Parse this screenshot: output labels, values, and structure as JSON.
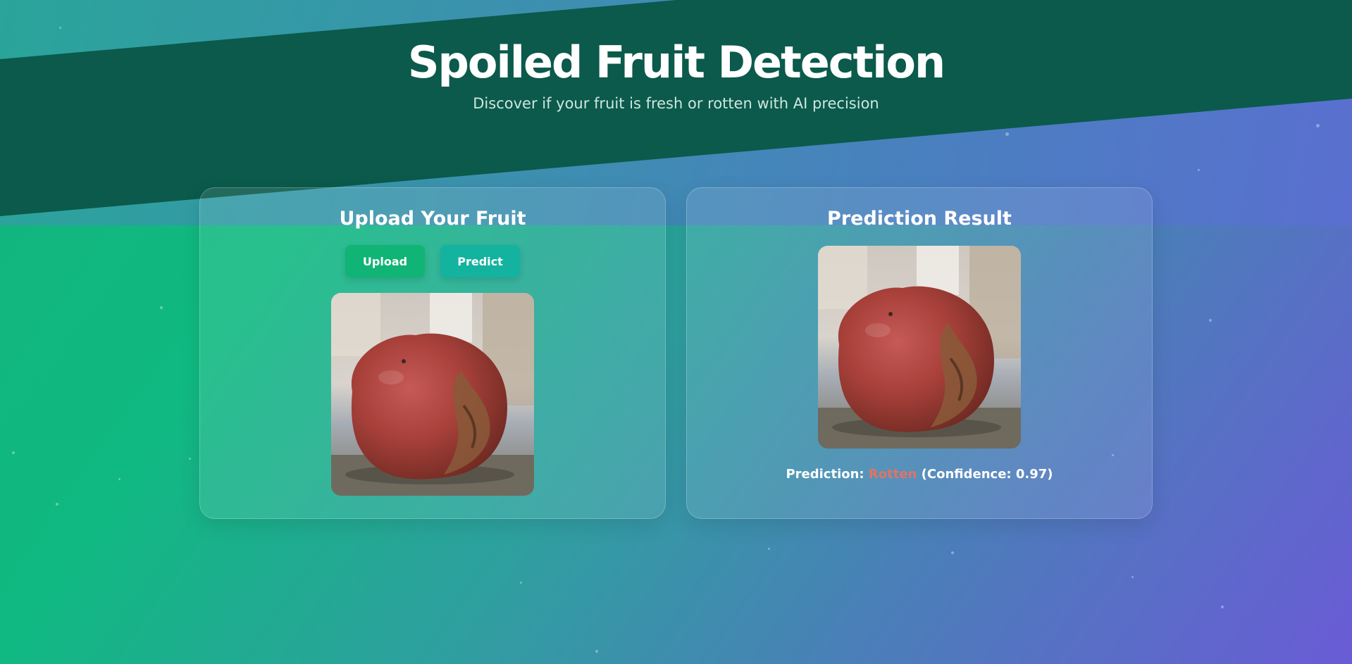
{
  "header": {
    "title": "Spoiled Fruit Detection",
    "subtitle": "Discover if your fruit is fresh or rotten with AI precision"
  },
  "upload_card": {
    "title": "Upload Your Fruit",
    "upload_label": "Upload",
    "predict_label": "Predict"
  },
  "result_card": {
    "title": "Prediction Result",
    "prediction_prefix": "Prediction:",
    "prediction_value": "Rotten",
    "confidence_text": "(Confidence: 0.97)"
  },
  "colors": {
    "band": "#0b5a4b",
    "upload_button": "#10b474",
    "predict_button": "#13b3a0",
    "rotten_text": "#e07466"
  }
}
